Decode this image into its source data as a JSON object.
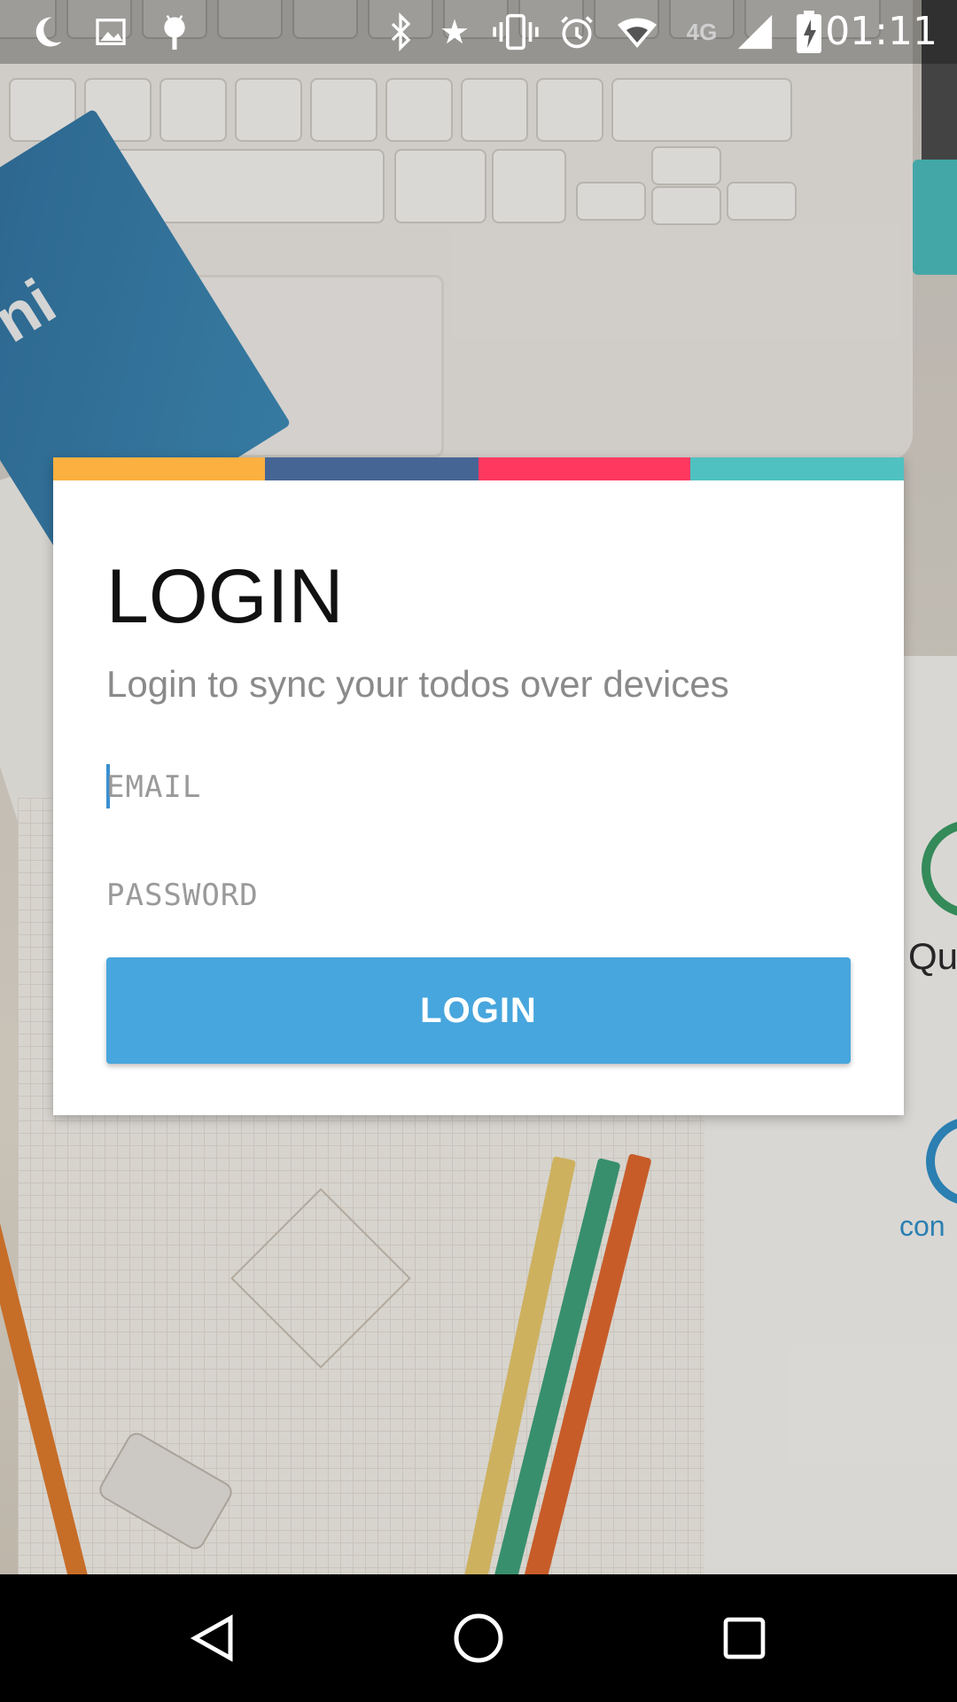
{
  "status_bar": {
    "time": "01:11",
    "network_label": "4G",
    "icons": [
      "moon-icon",
      "image-icon",
      "android-icon",
      "bluetooth-icon",
      "star-icon",
      "vibrate-icon",
      "alarm-icon",
      "wifi-icon",
      "signal-icon",
      "battery-charging-icon"
    ]
  },
  "dialog": {
    "title": "LOGIN",
    "subtitle": "Login to sync your todos over devices",
    "email_placeholder": "EMAIL",
    "password_placeholder": "PASSWORD",
    "login_button": "LOGIN",
    "stripe_colors": [
      "#FBB040",
      "#456695",
      "#FF3860",
      "#4FC1C1"
    ]
  },
  "background": {
    "booklet_text": "ni",
    "right_text_1": "Qu",
    "right_text_2": "con"
  },
  "nav_bar": {
    "buttons": [
      "back-icon",
      "home-icon",
      "recents-icon"
    ]
  }
}
